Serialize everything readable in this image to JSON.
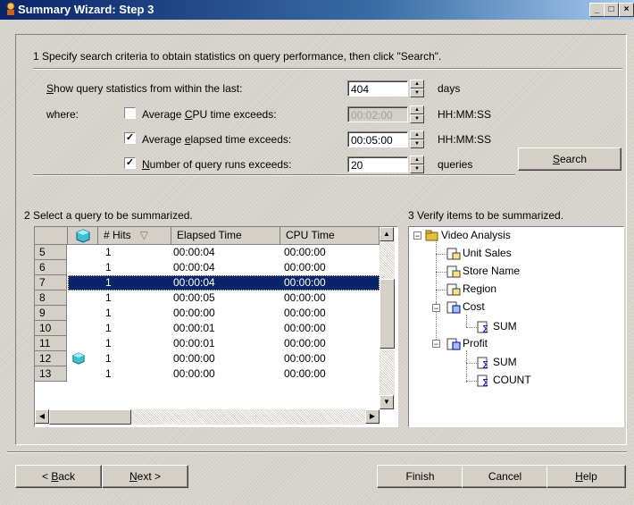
{
  "window": {
    "title": "Summary Wizard: Step 3"
  },
  "step1": {
    "heading": "1 Specify search criteria to obtain statistics on query performance, then click \"Search\".",
    "show_label_pre": "S",
    "show_label_rest": "how query statistics from within the last:",
    "days_value": "404",
    "days_unit": "days",
    "where_label": "where:",
    "cpu_label_pre": "Average ",
    "cpu_label_u": "C",
    "cpu_label_post": "PU time exceeds:",
    "cpu_checked": false,
    "cpu_value": "00:02:00",
    "cpu_unit": "HH:MM:SS",
    "elapsed_label_pre": "Average ",
    "elapsed_label_u": "e",
    "elapsed_label_post": "lapsed time exceeds:",
    "elapsed_checked": true,
    "elapsed_value": "00:05:00",
    "elapsed_unit": "HH:MM:SS",
    "runs_label_u": "N",
    "runs_label_post": "umber of query runs exceeds:",
    "runs_checked": true,
    "runs_value": "20",
    "runs_unit": "queries",
    "search_u": "S",
    "search_rest": "earch"
  },
  "step2": {
    "heading": "2 Select a query to be summarized.",
    "columns": {
      "hits": "# Hits",
      "elapsed": "Elapsed Time",
      "cpu": "CPU Time"
    },
    "rows": [
      {
        "num": "5",
        "hits": "1",
        "elapsed": "00:00:04",
        "cpu": "00:00:00",
        "selected": false,
        "icon": false
      },
      {
        "num": "6",
        "hits": "1",
        "elapsed": "00:00:04",
        "cpu": "00:00:00",
        "selected": false,
        "icon": false
      },
      {
        "num": "7",
        "hits": "1",
        "elapsed": "00:00:04",
        "cpu": "00:00:00",
        "selected": true,
        "icon": false
      },
      {
        "num": "8",
        "hits": "1",
        "elapsed": "00:00:05",
        "cpu": "00:00:00",
        "selected": false,
        "icon": false
      },
      {
        "num": "9",
        "hits": "1",
        "elapsed": "00:00:00",
        "cpu": "00:00:00",
        "selected": false,
        "icon": false
      },
      {
        "num": "10",
        "hits": "1",
        "elapsed": "00:00:01",
        "cpu": "00:00:00",
        "selected": false,
        "icon": false
      },
      {
        "num": "11",
        "hits": "1",
        "elapsed": "00:00:01",
        "cpu": "00:00:00",
        "selected": false,
        "icon": false
      },
      {
        "num": "12",
        "hits": "1",
        "elapsed": "00:00:00",
        "cpu": "00:00:00",
        "selected": false,
        "icon": true
      },
      {
        "num": "13",
        "hits": "1",
        "elapsed": "00:00:00",
        "cpu": "00:00:00",
        "selected": false,
        "icon": false
      }
    ]
  },
  "step3": {
    "heading": "3 Verify items to be summarized.",
    "root": "Video Analysis",
    "items": {
      "unit_sales": "Unit Sales",
      "store_name": "Store Name",
      "region": "Region",
      "cost": "Cost",
      "cost_sum": "SUM",
      "profit": "Profit",
      "profit_sum": "SUM",
      "profit_count": "COUNT"
    }
  },
  "footer": {
    "back_pre": "< ",
    "back_u": "B",
    "back_rest": "ack",
    "next_u": "N",
    "next_rest": "ext >",
    "finish": "Finish",
    "cancel": "Cancel",
    "help_u": "H",
    "help_rest": "elp"
  }
}
